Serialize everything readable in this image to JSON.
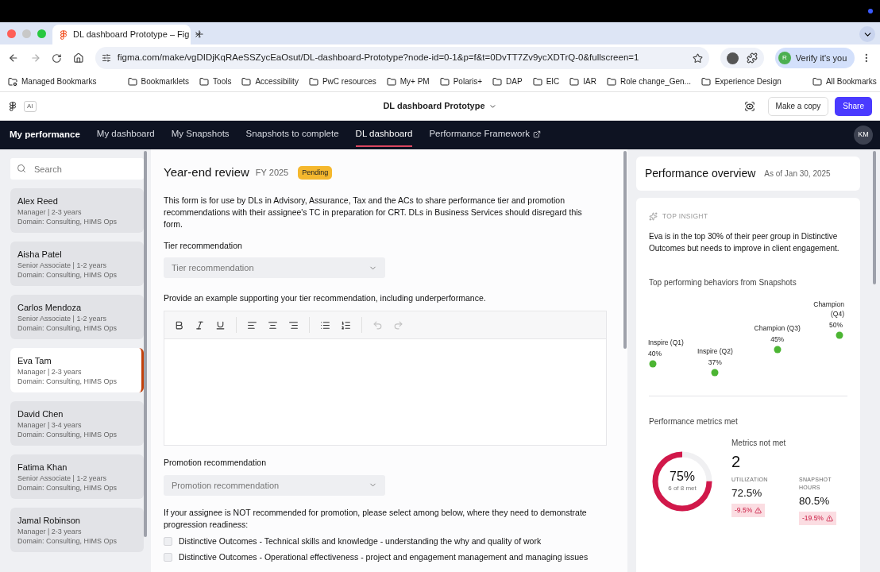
{
  "browser": {
    "tab_title": "DL dashboard Prototype – Fig",
    "url": "figma.com/make/vgDIDjKqRAeSSZycEaOsut/DL-dashboard-Prototype?node-id=0-1&p=f&t=0DvTT7Zv9ycXDTrQ-0&fullscreen=1",
    "profile_button": "Verify it's you",
    "profile_initial": "R",
    "bookmarks": [
      "Managed Bookmarks",
      "Bookmarklets",
      "Tools",
      "Accessibility",
      "PwC resources",
      "My+ PM",
      "Polaris+",
      "DAP",
      "EIC",
      "IAR",
      "Role change_Gen...",
      "Experience Design"
    ],
    "all_bookmarks": "All Bookmarks"
  },
  "figma_bar": {
    "ai_badge": "AI",
    "title": "DL dashboard Prototype",
    "copy_button": "Make a copy",
    "share_button": "Share"
  },
  "nav": {
    "brand": "My performance",
    "items": [
      {
        "label": "My dashboard",
        "selected": false,
        "external": false
      },
      {
        "label": "My Snapshots",
        "selected": false,
        "external": false
      },
      {
        "label": "Snapshots to complete",
        "selected": false,
        "external": false
      },
      {
        "label": "DL dashboard",
        "selected": true,
        "external": false
      },
      {
        "label": "Performance Framework",
        "selected": false,
        "external": true
      }
    ],
    "avatar": "KM"
  },
  "sidebar": {
    "search": {
      "placeholder": "Search"
    },
    "people": [
      {
        "name": "Alex Reed",
        "role": "Manager | 2-3 years",
        "domain": "Domain: Consulting, HIMS Ops",
        "selected": false
      },
      {
        "name": "Aisha Patel",
        "role": "Senior Associate | 1-2 years",
        "domain": "Domain: Consulting, HIMS Ops",
        "selected": false
      },
      {
        "name": "Carlos Mendoza",
        "role": "Senior Associate | 1-2 years",
        "domain": "Domain: Consulting, HIMS Ops",
        "selected": false
      },
      {
        "name": "Eva Tam",
        "role": "Manager | 2-3 years",
        "domain": "Domain: Consulting, HIMS Ops",
        "selected": true
      },
      {
        "name": "David Chen",
        "role": "Manager | 3-4 years",
        "domain": "Domain: Consulting, HIMS Ops",
        "selected": false
      },
      {
        "name": "Fatima Khan",
        "role": "Senior Associate | 1-2 years",
        "domain": "Domain: Consulting, HIMS Ops",
        "selected": false
      },
      {
        "name": "Jamal Robinson",
        "role": "Manager | 2-3 years",
        "domain": "Domain: Consulting, HIMS Ops",
        "selected": false
      }
    ]
  },
  "form": {
    "title": "Year-end review",
    "year": "FY 2025",
    "status": "Pending",
    "description": "This form is for use by DLs in Advisory, Assurance, Tax and the ACs to share performance tier and promotion recommendations with their assignee's TC in preparation for CRT. DLs in Business Services should disregard this form.",
    "tier_label": "Tier recommendation",
    "tier_select": {
      "placeholder": "Tier recommendation"
    },
    "example_label": "Provide an example supporting your tier recommendation, including underperformance.",
    "promotion_label": "Promotion recommendation",
    "promotion_select": {
      "placeholder": "Promotion recommendation"
    },
    "readiness_question": "If your assignee is NOT recommended for promotion, please select among below, where they need to demonstrate progression readiness:",
    "readiness_options": [
      {
        "label": "Distinctive Outcomes - Technical skills and knowledge - understanding the why and quality of work",
        "checked": false
      },
      {
        "label": "Distinctive Outcomes - Operational effectiveness - project and engagement management and managing issues",
        "checked": false
      }
    ]
  },
  "overview": {
    "title": "Performance overview",
    "as_of": "As of Jan 30, 2025",
    "insight_label": "TOP INSIGHT",
    "insight": "Eva is in the top 30% of their peer group in Distinctive Outcomes but needs to improve in client engagement.",
    "behaviors": {
      "title": "Top performing behaviors from Snapshots",
      "items": [
        {
          "label": "Inspire (Q1)",
          "value": "40%"
        },
        {
          "label": "Inspire (Q2)",
          "value": "37%"
        },
        {
          "label": "Champion (Q3)",
          "value": "45%"
        },
        {
          "label": "Champion (Q4)",
          "value": "50%"
        }
      ]
    },
    "metrics_title": "Performance metrics met",
    "met": {
      "level": 0.75,
      "percent": "75%",
      "caption": "6 of 8 met"
    },
    "not_met_label": "Metrics not met",
    "not_met_count": "2",
    "metrics": [
      {
        "label": "UTILIZATION",
        "value": "72.5%",
        "delta": "-9.5%"
      },
      {
        "label": "SNAPSHOT HOURS",
        "value": "80.5%",
        "delta": "-19.5%"
      }
    ]
  }
}
